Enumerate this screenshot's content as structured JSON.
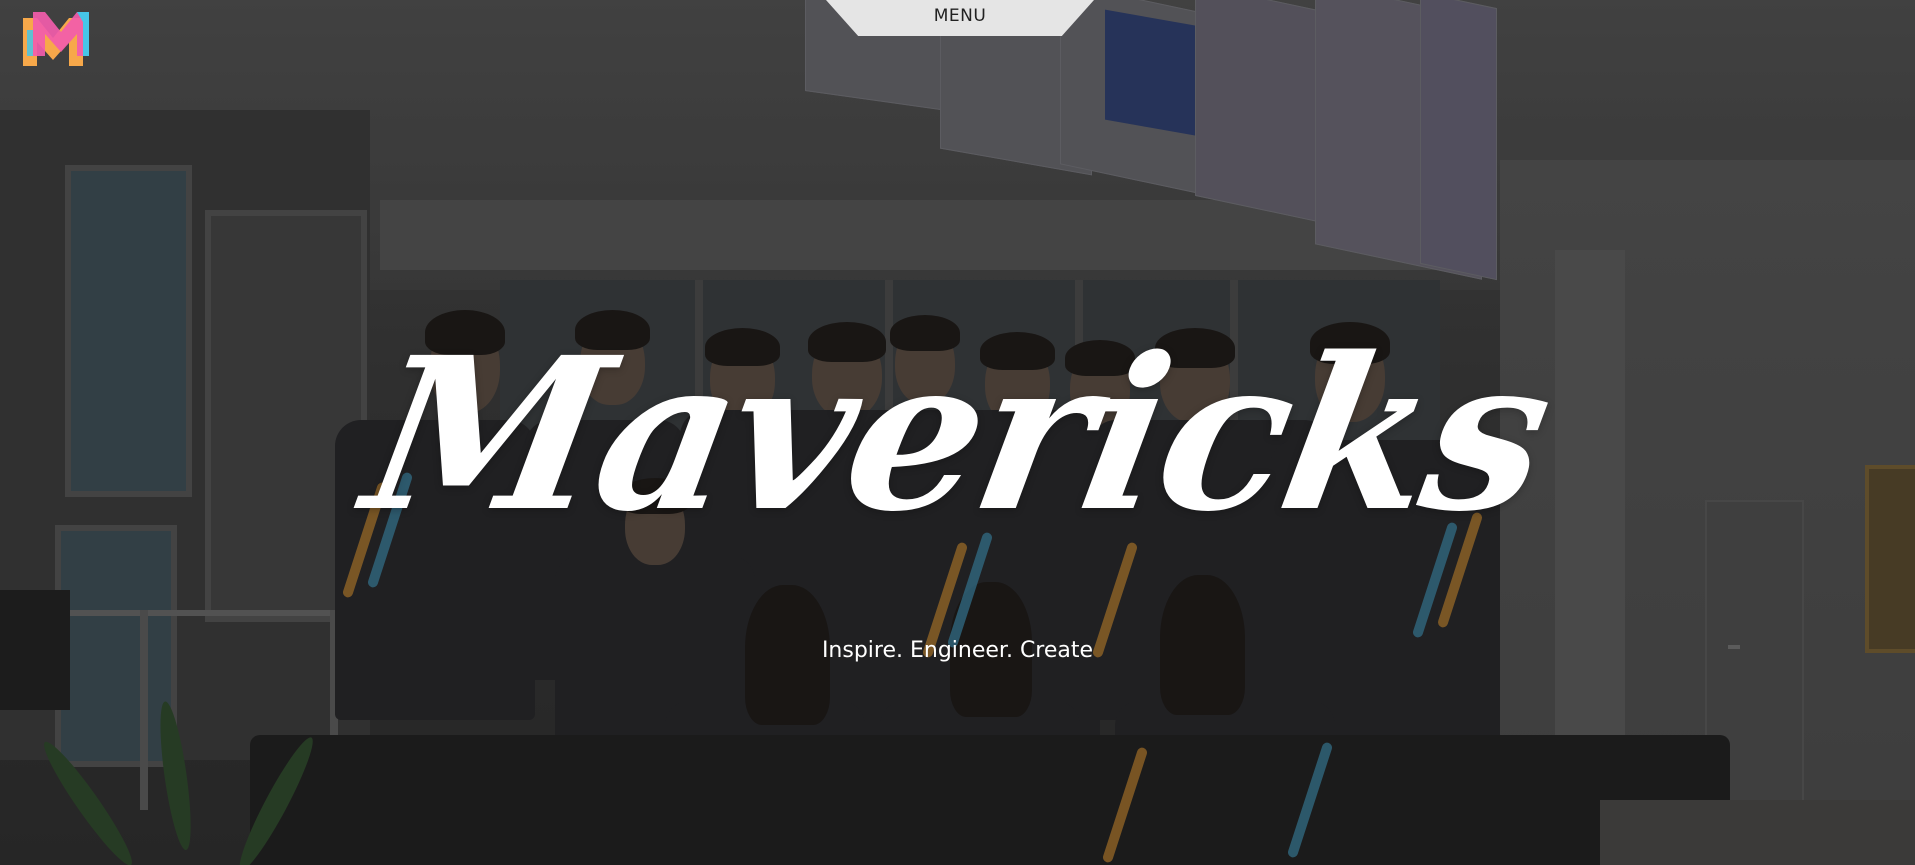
{
  "header": {
    "logo_icon": "mavericks-m-logo-icon",
    "menu_label": "MENU"
  },
  "hero": {
    "title": "Mavericks",
    "tagline": "Inspire. Engineer. Create",
    "background": "team-photo"
  },
  "colors": {
    "logo_pink": "#f25cab",
    "logo_orange": "#f7a84a",
    "logo_cyan": "#46c6e8",
    "menu_bg": "#e5e5e5",
    "text": "#ffffff"
  }
}
